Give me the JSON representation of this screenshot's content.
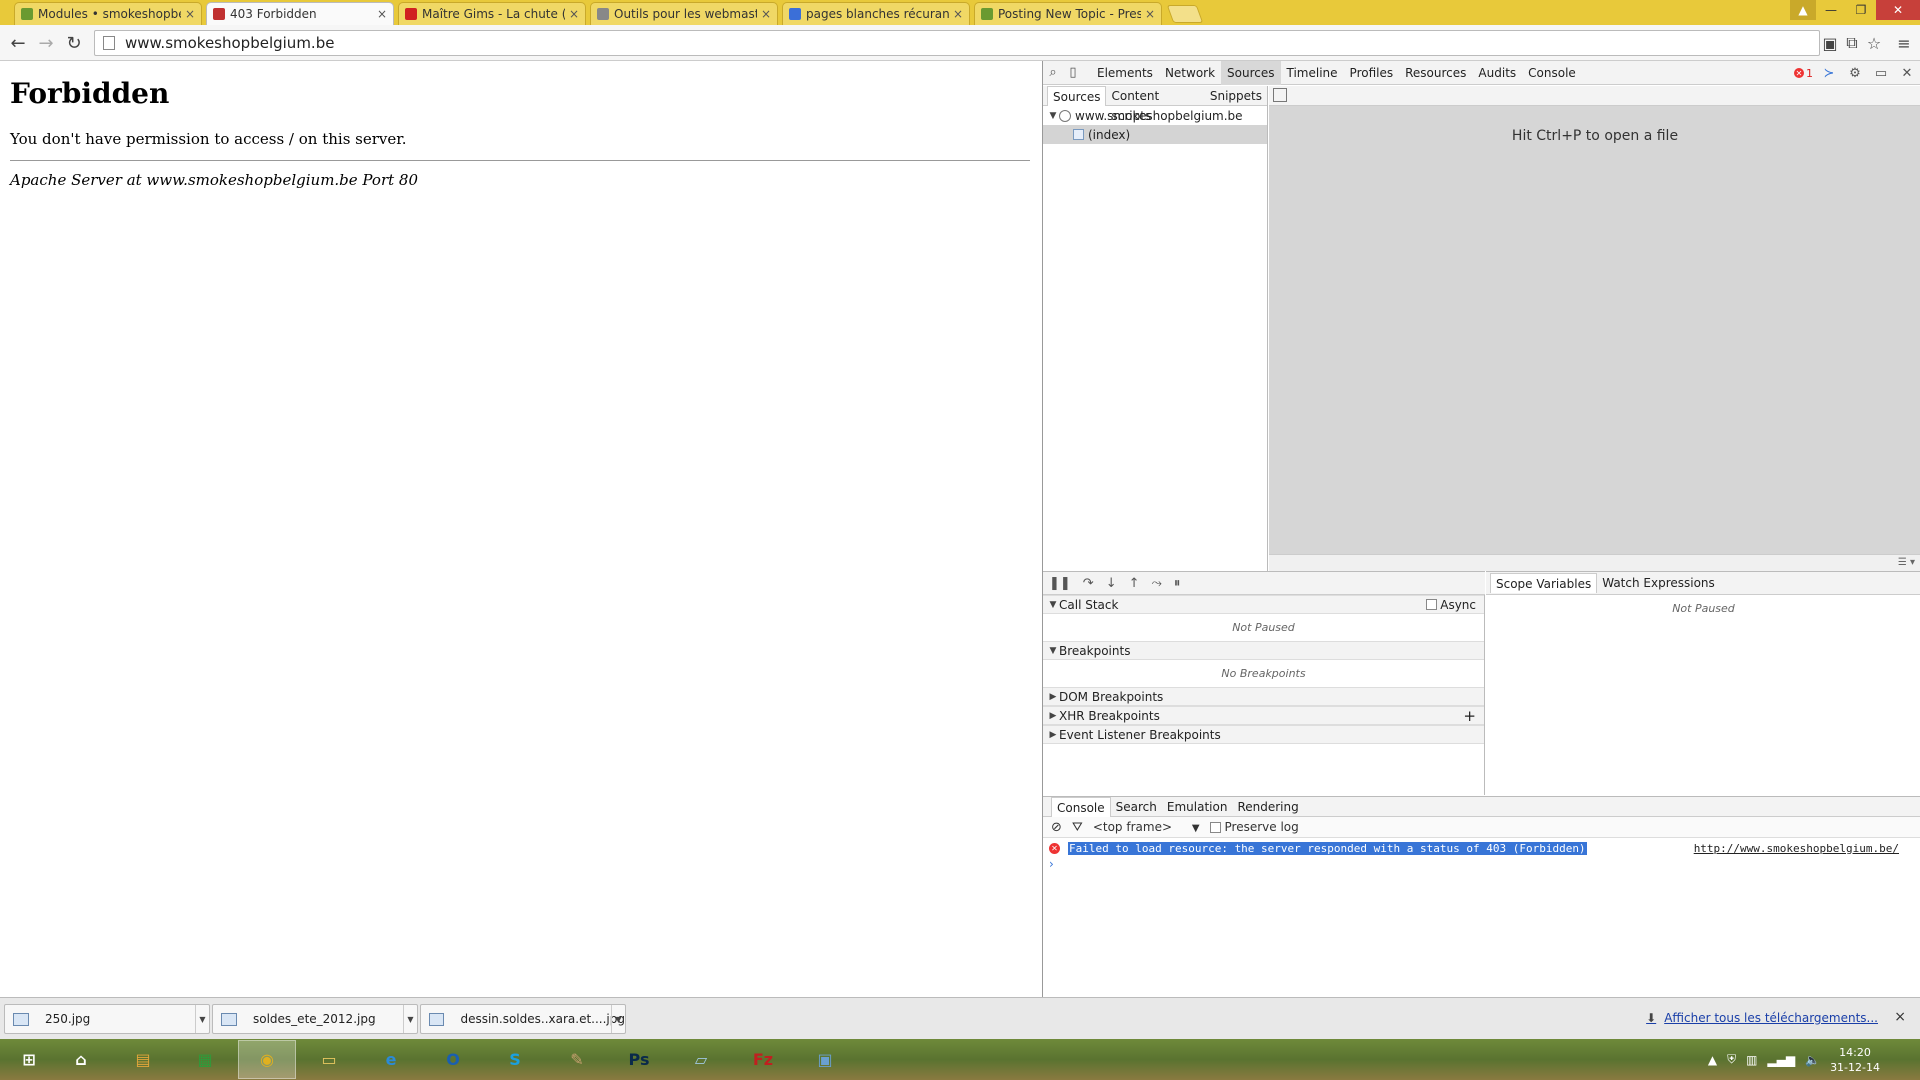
{
  "browser": {
    "tabs": [
      {
        "label": "Modules • smokeshopbelgium",
        "icon": "leaf-icon",
        "color": "#6a9a30",
        "active": false
      },
      {
        "label": "403 Forbidden",
        "icon": "pause-icon",
        "color": "#c03030",
        "active": true
      },
      {
        "label": "Maître Gims - La chute (P...",
        "icon": "youtube-icon",
        "color": "#d02020",
        "active": false
      },
      {
        "label": "Outils pour les webmaster...",
        "icon": "page-icon",
        "color": "#888888",
        "active": false
      },
      {
        "label": "pages blanches récurant -...",
        "icon": "google-icon",
        "color": "#3b6fd8",
        "active": false
      },
      {
        "label": "Posting New Topic - Prest...",
        "icon": "leaf-icon",
        "color": "#6a9a30",
        "active": false
      }
    ],
    "tab_close": "×",
    "url": "www.smokeshopbelgium.be"
  },
  "page": {
    "heading": "Forbidden",
    "message": "You don't have permission to access / on this server.",
    "footer": "Apache Server at www.smokeshopbelgium.be Port 80"
  },
  "devtools": {
    "panels": [
      "Elements",
      "Network",
      "Sources",
      "Timeline",
      "Profiles",
      "Resources",
      "Audits",
      "Console"
    ],
    "selected_panel": "Sources",
    "error_count": "1",
    "navigator_tabs": [
      "Sources",
      "Content scripts",
      "Snippets"
    ],
    "tree": {
      "domain": "www.smokeshopbelgium.be",
      "file": "(index)"
    },
    "editor_hint": "Hit Ctrl+P to open a file",
    "call_stack": {
      "title": "Call Stack",
      "async_label": "Async",
      "empty": "Not Paused"
    },
    "breakpoints": {
      "title": "Breakpoints",
      "empty": "No Breakpoints"
    },
    "dom_breakpoints": "DOM Breakpoints",
    "xhr_breakpoints": "XHR Breakpoints",
    "event_listener_breakpoints": "Event Listener Breakpoints",
    "scope_tabs": [
      "Scope Variables",
      "Watch Expressions"
    ],
    "scope_empty": "Not Paused",
    "drawer_tabs": [
      "Console",
      "Search",
      "Emulation",
      "Rendering"
    ],
    "console": {
      "frame": "<top frame>",
      "preserve_log": "Preserve log",
      "message": "Failed to load resource: the server responded with a status of 403 (Forbidden)",
      "source_url": "http://www.smokeshopbelgium.be/",
      "prompt": "›"
    }
  },
  "downloads": {
    "items": [
      "250.jpg",
      "soldes_ete_2012.jpg",
      "dessin.soldes..xara.et....jpg"
    ],
    "show_all": "Afficher tous les téléchargements...",
    "close": "×"
  },
  "taskbar": {
    "apps": [
      {
        "name": "windows-start-icon",
        "glyph": "⊞",
        "color": "#ffffff"
      },
      {
        "name": "home-icon",
        "glyph": "⌂",
        "color": "#ffffff"
      },
      {
        "name": "notes-app-icon",
        "glyph": "▤",
        "color": "#e3a63a"
      },
      {
        "name": "spreadsheet-app-icon",
        "glyph": "▦",
        "color": "#2f9a3a"
      },
      {
        "name": "chrome-icon",
        "glyph": "◉",
        "color": "#e0b020"
      },
      {
        "name": "file-explorer-icon",
        "glyph": "▭",
        "color": "#e8c860"
      },
      {
        "name": "internet-explorer-icon",
        "glyph": "e",
        "color": "#2a8ad8"
      },
      {
        "name": "outlook-icon",
        "glyph": "O",
        "color": "#1a5fb0"
      },
      {
        "name": "skype-icon",
        "glyph": "S",
        "color": "#1aa0e0"
      },
      {
        "name": "paint-app-icon",
        "glyph": "✎",
        "color": "#c8a070"
      },
      {
        "name": "photoshop-icon",
        "glyph": "Ps",
        "color": "#0a2a4a"
      },
      {
        "name": "notepad-app-icon",
        "glyph": "▱",
        "color": "#a0c8e0"
      },
      {
        "name": "filezilla-icon",
        "glyph": "Fz",
        "color": "#c02020"
      },
      {
        "name": "remote-desktop-icon",
        "glyph": "▣",
        "color": "#6aa0d0"
      }
    ],
    "clock_time": "14:20",
    "clock_date": "31-12-14"
  }
}
